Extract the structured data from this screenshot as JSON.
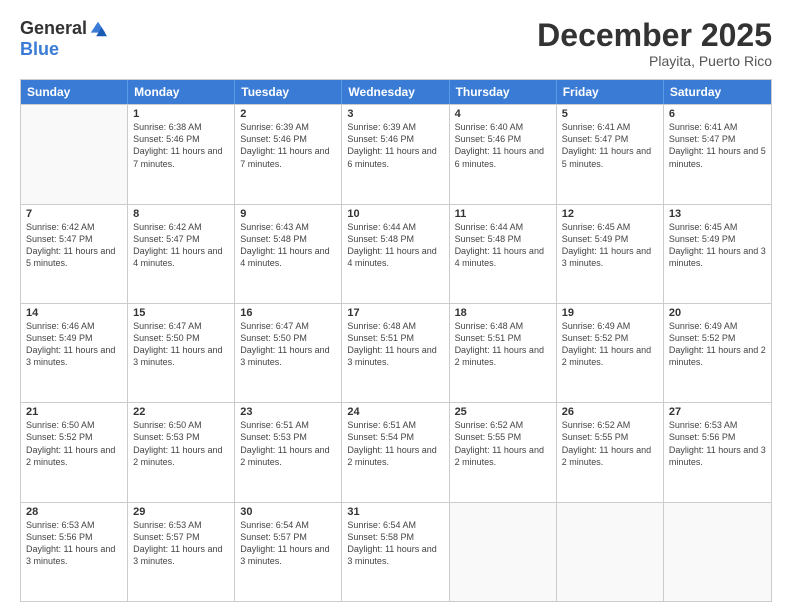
{
  "logo": {
    "general": "General",
    "blue": "Blue"
  },
  "title": "December 2025",
  "location": "Playita, Puerto Rico",
  "header_days": [
    "Sunday",
    "Monday",
    "Tuesday",
    "Wednesday",
    "Thursday",
    "Friday",
    "Saturday"
  ],
  "weeks": [
    [
      {
        "day": "",
        "sunrise": "",
        "sunset": "",
        "daylight": ""
      },
      {
        "day": "1",
        "sunrise": "Sunrise: 6:38 AM",
        "sunset": "Sunset: 5:46 PM",
        "daylight": "Daylight: 11 hours and 7 minutes."
      },
      {
        "day": "2",
        "sunrise": "Sunrise: 6:39 AM",
        "sunset": "Sunset: 5:46 PM",
        "daylight": "Daylight: 11 hours and 7 minutes."
      },
      {
        "day": "3",
        "sunrise": "Sunrise: 6:39 AM",
        "sunset": "Sunset: 5:46 PM",
        "daylight": "Daylight: 11 hours and 6 minutes."
      },
      {
        "day": "4",
        "sunrise": "Sunrise: 6:40 AM",
        "sunset": "Sunset: 5:46 PM",
        "daylight": "Daylight: 11 hours and 6 minutes."
      },
      {
        "day": "5",
        "sunrise": "Sunrise: 6:41 AM",
        "sunset": "Sunset: 5:47 PM",
        "daylight": "Daylight: 11 hours and 5 minutes."
      },
      {
        "day": "6",
        "sunrise": "Sunrise: 6:41 AM",
        "sunset": "Sunset: 5:47 PM",
        "daylight": "Daylight: 11 hours and 5 minutes."
      }
    ],
    [
      {
        "day": "7",
        "sunrise": "Sunrise: 6:42 AM",
        "sunset": "Sunset: 5:47 PM",
        "daylight": "Daylight: 11 hours and 5 minutes."
      },
      {
        "day": "8",
        "sunrise": "Sunrise: 6:42 AM",
        "sunset": "Sunset: 5:47 PM",
        "daylight": "Daylight: 11 hours and 4 minutes."
      },
      {
        "day": "9",
        "sunrise": "Sunrise: 6:43 AM",
        "sunset": "Sunset: 5:48 PM",
        "daylight": "Daylight: 11 hours and 4 minutes."
      },
      {
        "day": "10",
        "sunrise": "Sunrise: 6:44 AM",
        "sunset": "Sunset: 5:48 PM",
        "daylight": "Daylight: 11 hours and 4 minutes."
      },
      {
        "day": "11",
        "sunrise": "Sunrise: 6:44 AM",
        "sunset": "Sunset: 5:48 PM",
        "daylight": "Daylight: 11 hours and 4 minutes."
      },
      {
        "day": "12",
        "sunrise": "Sunrise: 6:45 AM",
        "sunset": "Sunset: 5:49 PM",
        "daylight": "Daylight: 11 hours and 3 minutes."
      },
      {
        "day": "13",
        "sunrise": "Sunrise: 6:45 AM",
        "sunset": "Sunset: 5:49 PM",
        "daylight": "Daylight: 11 hours and 3 minutes."
      }
    ],
    [
      {
        "day": "14",
        "sunrise": "Sunrise: 6:46 AM",
        "sunset": "Sunset: 5:49 PM",
        "daylight": "Daylight: 11 hours and 3 minutes."
      },
      {
        "day": "15",
        "sunrise": "Sunrise: 6:47 AM",
        "sunset": "Sunset: 5:50 PM",
        "daylight": "Daylight: 11 hours and 3 minutes."
      },
      {
        "day": "16",
        "sunrise": "Sunrise: 6:47 AM",
        "sunset": "Sunset: 5:50 PM",
        "daylight": "Daylight: 11 hours and 3 minutes."
      },
      {
        "day": "17",
        "sunrise": "Sunrise: 6:48 AM",
        "sunset": "Sunset: 5:51 PM",
        "daylight": "Daylight: 11 hours and 3 minutes."
      },
      {
        "day": "18",
        "sunrise": "Sunrise: 6:48 AM",
        "sunset": "Sunset: 5:51 PM",
        "daylight": "Daylight: 11 hours and 2 minutes."
      },
      {
        "day": "19",
        "sunrise": "Sunrise: 6:49 AM",
        "sunset": "Sunset: 5:52 PM",
        "daylight": "Daylight: 11 hours and 2 minutes."
      },
      {
        "day": "20",
        "sunrise": "Sunrise: 6:49 AM",
        "sunset": "Sunset: 5:52 PM",
        "daylight": "Daylight: 11 hours and 2 minutes."
      }
    ],
    [
      {
        "day": "21",
        "sunrise": "Sunrise: 6:50 AM",
        "sunset": "Sunset: 5:52 PM",
        "daylight": "Daylight: 11 hours and 2 minutes."
      },
      {
        "day": "22",
        "sunrise": "Sunrise: 6:50 AM",
        "sunset": "Sunset: 5:53 PM",
        "daylight": "Daylight: 11 hours and 2 minutes."
      },
      {
        "day": "23",
        "sunrise": "Sunrise: 6:51 AM",
        "sunset": "Sunset: 5:53 PM",
        "daylight": "Daylight: 11 hours and 2 minutes."
      },
      {
        "day": "24",
        "sunrise": "Sunrise: 6:51 AM",
        "sunset": "Sunset: 5:54 PM",
        "daylight": "Daylight: 11 hours and 2 minutes."
      },
      {
        "day": "25",
        "sunrise": "Sunrise: 6:52 AM",
        "sunset": "Sunset: 5:55 PM",
        "daylight": "Daylight: 11 hours and 2 minutes."
      },
      {
        "day": "26",
        "sunrise": "Sunrise: 6:52 AM",
        "sunset": "Sunset: 5:55 PM",
        "daylight": "Daylight: 11 hours and 2 minutes."
      },
      {
        "day": "27",
        "sunrise": "Sunrise: 6:53 AM",
        "sunset": "Sunset: 5:56 PM",
        "daylight": "Daylight: 11 hours and 3 minutes."
      }
    ],
    [
      {
        "day": "28",
        "sunrise": "Sunrise: 6:53 AM",
        "sunset": "Sunset: 5:56 PM",
        "daylight": "Daylight: 11 hours and 3 minutes."
      },
      {
        "day": "29",
        "sunrise": "Sunrise: 6:53 AM",
        "sunset": "Sunset: 5:57 PM",
        "daylight": "Daylight: 11 hours and 3 minutes."
      },
      {
        "day": "30",
        "sunrise": "Sunrise: 6:54 AM",
        "sunset": "Sunset: 5:57 PM",
        "daylight": "Daylight: 11 hours and 3 minutes."
      },
      {
        "day": "31",
        "sunrise": "Sunrise: 6:54 AM",
        "sunset": "Sunset: 5:58 PM",
        "daylight": "Daylight: 11 hours and 3 minutes."
      },
      {
        "day": "",
        "sunrise": "",
        "sunset": "",
        "daylight": ""
      },
      {
        "day": "",
        "sunrise": "",
        "sunset": "",
        "daylight": ""
      },
      {
        "day": "",
        "sunrise": "",
        "sunset": "",
        "daylight": ""
      }
    ]
  ]
}
